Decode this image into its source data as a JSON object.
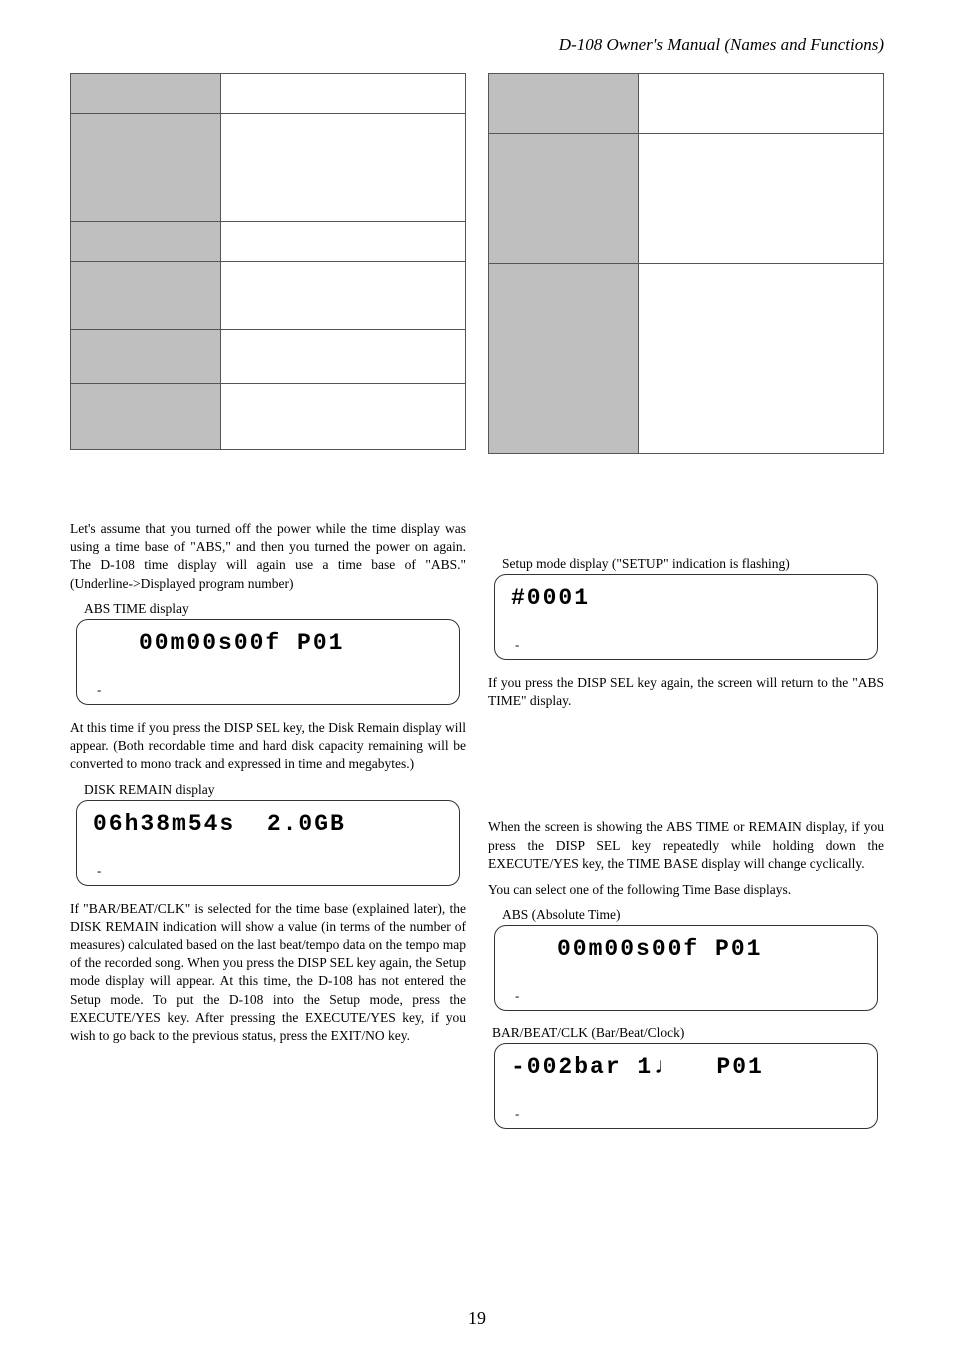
{
  "header": "D-108 Owner's Manual (Names and Functions)",
  "leftText1": "Let's assume that you turned off the power while the time display was using a time base of \"ABS,\" and then you turned the power on again.  The D-108 time display will again use a time base of \"ABS.\" (Underline->Displayed program number)",
  "caption1": "ABS TIME display",
  "lcd1": "00m00s00f P01",
  "tick": "-",
  "leftText2": "At this time if you press the DISP SEL key, the Disk Remain display will appear. (Both recordable time and hard disk capacity remaining will be converted to mono track and expressed in time and megabytes.)",
  "caption2": "DISK REMAIN display",
  "lcd2": "06h38m54s  2.0GB",
  "leftText3": "If \"BAR/BEAT/CLK\" is selected for the time base (explained later), the DISK REMAIN indication will show a value (in terms of the number of measures) calculated based on the last beat/tempo data on the tempo map of the recorded song.  When you press the DISP SEL key again, the Setup mode display will appear.  At this time, the D-108 has not entered the Setup mode.  To put the D-108 into the Setup mode, press the EXECUTE/YES key.  After pressing the EXECUTE/YES key, if you wish to go back to the previous status, press the EXIT/NO key.",
  "rightCaption1": "Setup mode display (\"SETUP\" indication is flashing)",
  "lcd3": "#0001",
  "rightText1": "If you press the DISP SEL key again, the screen will return to the \"ABS TIME\" display.",
  "rightText2": "When the screen is showing the ABS TIME or REMAIN display, if you press the DISP SEL key repeatedly while holding down the EXECUTE/YES key, the TIME BASE display will change cyclically.",
  "rightText3": "You can select one of the following Time Base displays.",
  "caption3": "ABS (Absolute Time)",
  "lcd4": "00m00s00f P01",
  "caption4": "BAR/BEAT/CLK (Bar/Beat/Clock)",
  "lcd5": "-002bar 1♩   P01",
  "pageNumber": "19"
}
